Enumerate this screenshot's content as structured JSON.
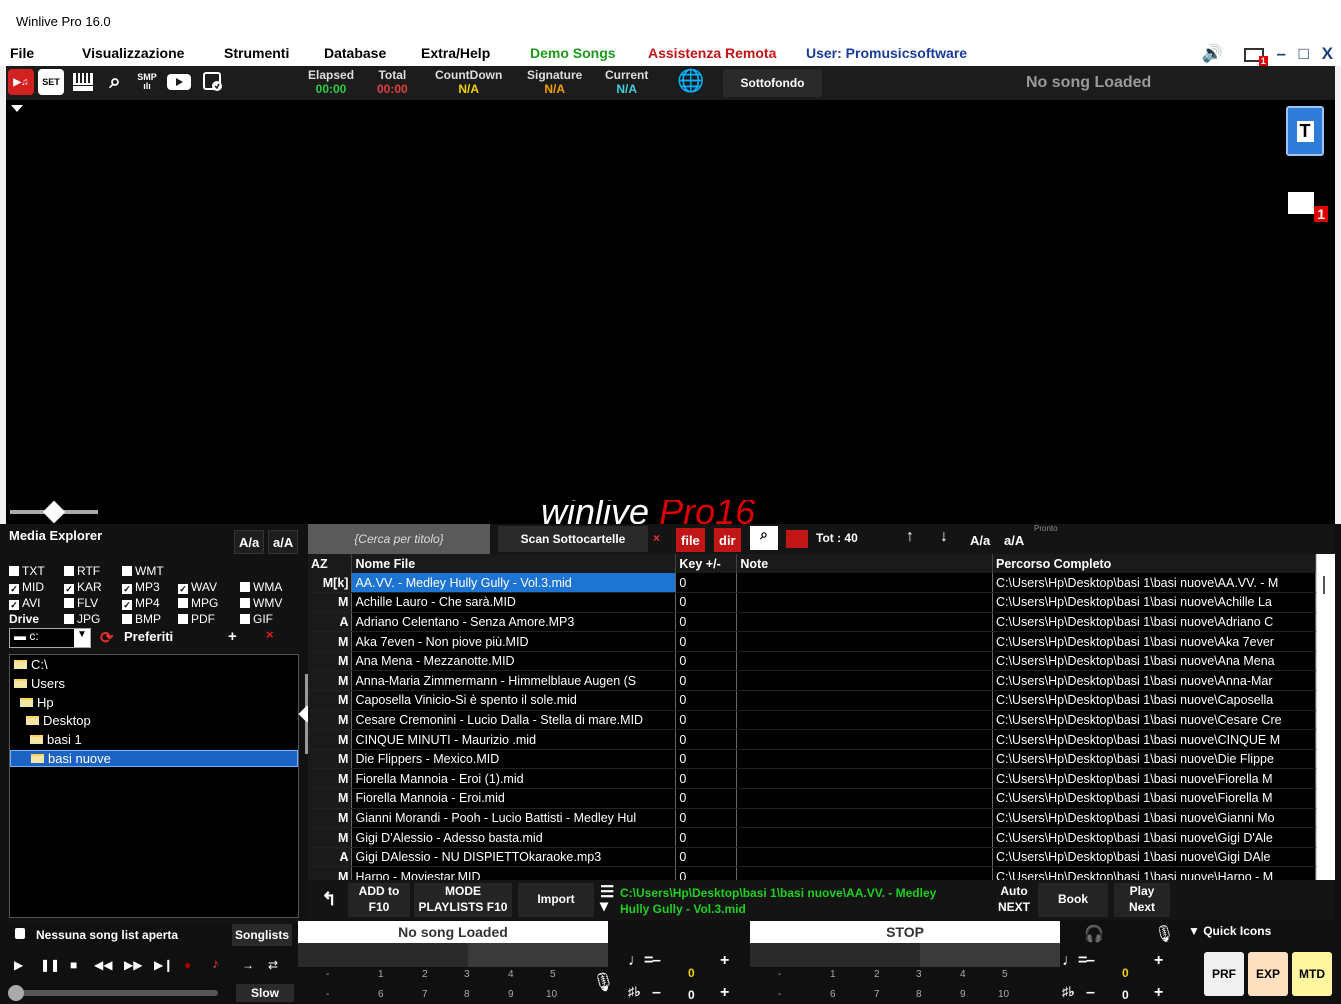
{
  "window": {
    "title": "Winlive Pro 16.0"
  },
  "menu": {
    "items": [
      {
        "label": "File",
        "color": "#000000"
      },
      {
        "label": "Visualizzazione",
        "color": "#000000"
      },
      {
        "label": "Strumenti",
        "color": "#000000"
      },
      {
        "label": "Database",
        "color": "#000000"
      },
      {
        "label": "Extra/Help",
        "color": "#000000"
      },
      {
        "label": "Demo Songs",
        "color": "#1a9a1a"
      },
      {
        "label": "Assistenza Remota",
        "color": "#c21515"
      },
      {
        "label": "User: Promusicsoftware",
        "color": "#1a3c9a"
      }
    ],
    "mail_badge": "1",
    "minimize": "–",
    "maximize": "□",
    "close": "X"
  },
  "toolbar": {
    "buttons": [
      "player-icon",
      "set-icon",
      "keyboard-icon",
      "search-icon",
      "smp-icon",
      "youtube-icon",
      "save-icon"
    ],
    "set_label": "SET",
    "smp_label": "SMP",
    "stats": [
      {
        "label": "Elapsed",
        "value": "00:00",
        "color": "#2ecc40"
      },
      {
        "label": "Total",
        "value": "00:00",
        "color": "#e04040"
      },
      {
        "label": "CountDown",
        "value": "N/A",
        "color": "#f0d000"
      },
      {
        "label": "Signature",
        "value": "N/A",
        "color": "#f0a000"
      },
      {
        "label": "Current",
        "value": "N/A",
        "color": "#40d0e0"
      }
    ],
    "sottofondo": "Sottofondo",
    "no_song": "No song Loaded"
  },
  "stage": {
    "t_button": "T",
    "mail_badge": "1",
    "logo_main": "winlive",
    "logo_accent": "Pro16"
  },
  "media_explorer": {
    "title": "Media Explorer",
    "case_upper": "A/a",
    "case_lower": "a/A",
    "filters": [
      {
        "label": "TXT",
        "checked": false
      },
      {
        "label": "RTF",
        "checked": false
      },
      {
        "label": "WMT",
        "checked": false
      },
      {
        "label": "MID",
        "checked": true
      },
      {
        "label": "KAR",
        "checked": true
      },
      {
        "label": "MP3",
        "checked": true
      },
      {
        "label": "WAV",
        "checked": true
      },
      {
        "label": "WMA",
        "checked": false
      },
      {
        "label": "AVI",
        "checked": true
      },
      {
        "label": "FLV",
        "checked": false
      },
      {
        "label": "MP4",
        "checked": true
      },
      {
        "label": "MPG",
        "checked": false
      },
      {
        "label": "WMV",
        "checked": false
      },
      {
        "label": "JPG",
        "checked": false
      },
      {
        "label": "BMP",
        "checked": false
      },
      {
        "label": "PDF",
        "checked": false
      },
      {
        "label": "GIF",
        "checked": false
      }
    ],
    "drive_label": "Drive",
    "drive_value": "c:",
    "preferiti": "Preferiti",
    "add": "+",
    "remove": "×",
    "tree": [
      {
        "label": "C:\\",
        "selected": false
      },
      {
        "label": "Users",
        "selected": false
      },
      {
        "label": "Hp",
        "selected": false
      },
      {
        "label": "Desktop",
        "selected": false
      },
      {
        "label": "basi 1",
        "selected": false
      },
      {
        "label": "basi nuove",
        "selected": true
      }
    ]
  },
  "search": {
    "placeholder": "{Cerca per titolo}",
    "scan": "Scan Sottocartelle",
    "clear": "×",
    "file": "file",
    "dir": "dir",
    "total": "Tot : 40",
    "up": "↑",
    "down": "↓",
    "case_upper": "A/a",
    "case_lower": "a/A",
    "status": "Pronto"
  },
  "table": {
    "headers": [
      "AZ",
      "Nome File",
      "Key +/-",
      "Note",
      "Percorso Completo"
    ],
    "rows": [
      {
        "t": "M[k]",
        "name": "AA.VV. - Medley Hully Gully - Vol.3.mid",
        "key": "0",
        "note": "",
        "path": "C:\\Users\\Hp\\Desktop\\basi 1\\basi nuove\\AA.VV. - M",
        "selected": true
      },
      {
        "t": "M",
        "name": "Achille Lauro - Che sarà.MID",
        "key": "0",
        "note": "",
        "path": "C:\\Users\\Hp\\Desktop\\basi 1\\basi nuove\\Achille La"
      },
      {
        "t": "A",
        "name": "Adriano Celentano - Senza Amore.MP3",
        "key": "0",
        "note": "",
        "path": "C:\\Users\\Hp\\Desktop\\basi 1\\basi nuove\\Adriano C"
      },
      {
        "t": "M",
        "name": "Aka 7even - Non piove più.MID",
        "key": "0",
        "note": "",
        "path": "C:\\Users\\Hp\\Desktop\\basi 1\\basi nuove\\Aka 7ever"
      },
      {
        "t": "M",
        "name": "Ana Mena - Mezzanotte.MID",
        "key": "0",
        "note": "",
        "path": "C:\\Users\\Hp\\Desktop\\basi 1\\basi nuove\\Ana Mena"
      },
      {
        "t": "M",
        "name": "Anna-Maria Zimmermann - Himmelblaue Augen (S",
        "key": "0",
        "note": "",
        "path": "C:\\Users\\Hp\\Desktop\\basi 1\\basi nuove\\Anna-Mar"
      },
      {
        "t": "M",
        "name": "Caposella Vinicio-Si è spento il sole.mid",
        "key": "0",
        "note": "",
        "path": "C:\\Users\\Hp\\Desktop\\basi 1\\basi nuove\\Caposella"
      },
      {
        "t": "M",
        "name": "Cesare Cremonini - Lucio Dalla - Stella di mare.MID",
        "key": "0",
        "note": "",
        "path": "C:\\Users\\Hp\\Desktop\\basi 1\\basi nuove\\Cesare Cre"
      },
      {
        "t": "M",
        "name": "CINQUE MINUTI - Maurizio .mid",
        "key": "0",
        "note": "",
        "path": "C:\\Users\\Hp\\Desktop\\basi 1\\basi nuove\\CINQUE M"
      },
      {
        "t": "M",
        "name": "Die Flippers - Mexico.MID",
        "key": "0",
        "note": "",
        "path": "C:\\Users\\Hp\\Desktop\\basi 1\\basi nuove\\Die Flippe"
      },
      {
        "t": "M",
        "name": "Fiorella Mannoia - Eroi (1).mid",
        "key": "0",
        "note": "",
        "path": "C:\\Users\\Hp\\Desktop\\basi 1\\basi nuove\\Fiorella M"
      },
      {
        "t": "M",
        "name": "Fiorella Mannoia - Eroi.mid",
        "key": "0",
        "note": "",
        "path": "C:\\Users\\Hp\\Desktop\\basi 1\\basi nuove\\Fiorella M"
      },
      {
        "t": "M",
        "name": "Gianni Morandi - Pooh - Lucio Battisti - Medley Hul",
        "key": "0",
        "note": "",
        "path": "C:\\Users\\Hp\\Desktop\\basi 1\\basi nuove\\Gianni Mo"
      },
      {
        "t": "M",
        "name": "Gigi D'Alessio - Adesso basta.mid",
        "key": "0",
        "note": "",
        "path": "C:\\Users\\Hp\\Desktop\\basi 1\\basi nuove\\Gigi D'Ale"
      },
      {
        "t": "A",
        "name": "Gigi DAlessio - NU DISPIETTOkaraoke.mp3",
        "key": "0",
        "note": "",
        "path": "C:\\Users\\Hp\\Desktop\\basi 1\\basi nuove\\Gigi DAle"
      },
      {
        "t": "M",
        "name": "Harpo - Moviestar.MID",
        "key": "0",
        "note": "",
        "path": "C:\\Users\\Hp\\Desktop\\basi 1\\basi nuove\\Harpo - M"
      }
    ]
  },
  "controls": {
    "add_to": "ADD to",
    "add_to_key": "F10",
    "mode": "MODE",
    "mode_sub": "PLAYLISTS F10",
    "import": "Import",
    "current_path_1": "C:\\Users\\Hp\\Desktop\\basi 1\\basi nuove\\AA.VV. - Medley",
    "current_path_2": "Hully Gully - Vol.3.mid",
    "auto": "Auto",
    "auto_sub": "NEXT",
    "book": "Book",
    "play": "Play",
    "play_sub": "Next"
  },
  "songlist": {
    "label": "Nessuna song list aperta",
    "button": "Songlists",
    "slow": "Slow"
  },
  "decks": {
    "left_title": "No song Loaded",
    "right_title": "STOP",
    "minus": "-",
    "row1": [
      "1",
      "2",
      "3",
      "4",
      "5"
    ],
    "row2": [
      "6",
      "7",
      "8",
      "9",
      "10"
    ],
    "tempo_val": "0",
    "pitch_val": "0",
    "plus": "+",
    "dash": "–"
  },
  "quick_icons": {
    "title": "Quick Icons",
    "items": [
      {
        "label": "PRF",
        "color": "#f0f0f0"
      },
      {
        "label": "EXP",
        "color": "#fde0c0"
      },
      {
        "label": "MTD",
        "color": "#fff6a0"
      }
    ]
  }
}
